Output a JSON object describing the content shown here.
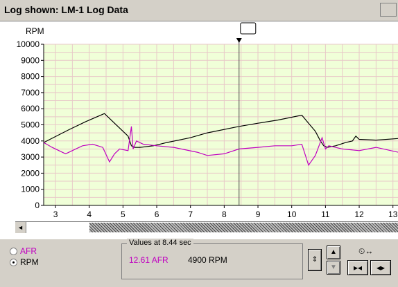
{
  "window": {
    "title": "Log shown: LM-1 Log Data"
  },
  "chart_data": {
    "type": "line",
    "ylabel": "RPM",
    "y_ticks": [
      "10000",
      "9000",
      "8000",
      "7000",
      "6000",
      "5000",
      "4000",
      "3000",
      "2000",
      "1000",
      "0"
    ],
    "x_ticks": [
      "3",
      "4",
      "5",
      "6",
      "7",
      "8",
      "9",
      "10",
      "11",
      "12",
      "13"
    ],
    "xlim": [
      2.65,
      13.15
    ],
    "ylim": [
      0,
      10000
    ],
    "cursor_x": 8.44,
    "background": "#f0ffd8",
    "series": [
      {
        "color": "#000000",
        "x": [
          2.65,
          3.4,
          3.9,
          4.45,
          4.9,
          5.15,
          5.25,
          5.35,
          5.5,
          5.9,
          6.3,
          7.0,
          7.5,
          8.44,
          9.0,
          9.6,
          10.3,
          10.5,
          10.7,
          10.85,
          10.95,
          11.05,
          11.3,
          11.6,
          11.8,
          11.9,
          12.0,
          12.5,
          13.15
        ],
        "y": [
          3900,
          4700,
          5200,
          5700,
          4800,
          4300,
          3700,
          3600,
          3600,
          3700,
          3900,
          4200,
          4500,
          4900,
          5100,
          5300,
          5600,
          5100,
          4600,
          4000,
          3700,
          3600,
          3700,
          3900,
          4000,
          4300,
          4100,
          4050,
          4150
        ]
      },
      {
        "color": "#c000c0",
        "x": [
          2.65,
          2.9,
          3.3,
          3.6,
          3.8,
          4.1,
          4.4,
          4.6,
          4.75,
          4.9,
          5.15,
          5.25,
          5.3,
          5.4,
          5.6,
          6.0,
          6.5,
          7.2,
          7.5,
          8.0,
          8.44,
          9.0,
          9.5,
          10.0,
          10.3,
          10.5,
          10.7,
          10.9,
          11.0,
          11.1,
          11.5,
          12.0,
          12.5,
          13.15
        ],
        "y": [
          3900,
          3600,
          3200,
          3500,
          3700,
          3800,
          3600,
          2700,
          3200,
          3500,
          3400,
          4900,
          3500,
          4000,
          3800,
          3700,
          3600,
          3300,
          3100,
          3200,
          3500,
          3600,
          3700,
          3700,
          3800,
          2500,
          3100,
          4200,
          3500,
          3700,
          3500,
          3400,
          3600,
          3300
        ]
      }
    ]
  },
  "scrollbar": {
    "left_arrow": "◄"
  },
  "mode": {
    "options": [
      {
        "label": "AFR",
        "selected": false,
        "color": "#c000c0"
      },
      {
        "label": "RPM",
        "selected": true,
        "color": "#000000"
      }
    ]
  },
  "values": {
    "legend": "Values at 8.44 sec",
    "afr": "12.61 AFR",
    "rpm": "4900 RPM"
  },
  "controls": {
    "zoom_vertical": "⇕",
    "up": "▲",
    "down": "▼",
    "time_icon": "⏲↔",
    "shrink": "▸◂",
    "expand": "◂▸"
  }
}
